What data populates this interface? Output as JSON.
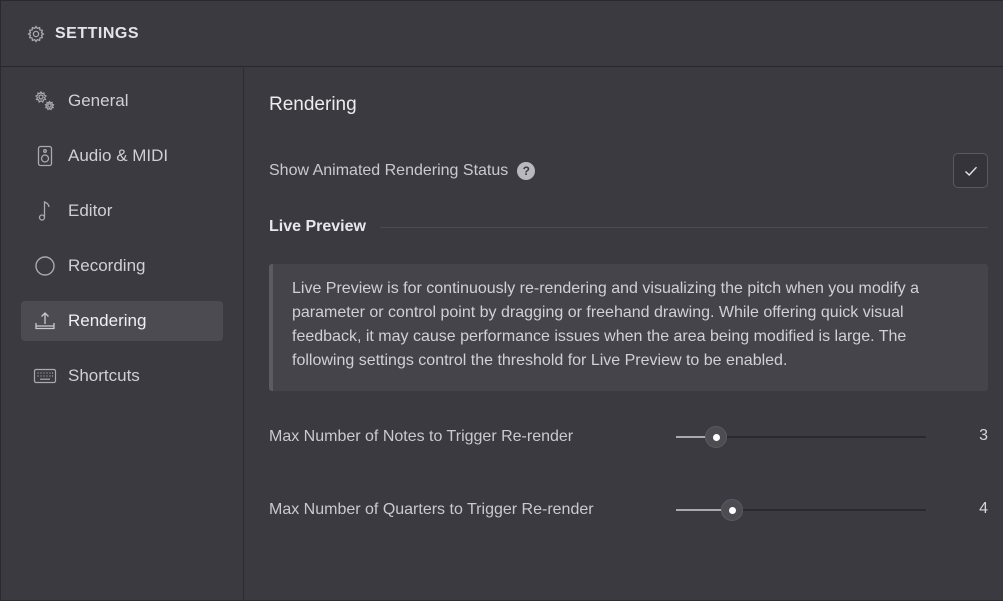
{
  "window": {
    "title": "SETTINGS",
    "icon": "gear-icon"
  },
  "sidebar": {
    "items": [
      {
        "label": "General",
        "icon": "gears-icon",
        "active": false
      },
      {
        "label": "Audio & MIDI",
        "icon": "speaker-icon",
        "active": false
      },
      {
        "label": "Editor",
        "icon": "music-note-icon",
        "active": false
      },
      {
        "label": "Recording",
        "icon": "record-circle-icon",
        "active": false
      },
      {
        "label": "Rendering",
        "icon": "upload-tray-icon",
        "active": true
      },
      {
        "label": "Shortcuts",
        "icon": "keyboard-icon",
        "active": false
      }
    ]
  },
  "main": {
    "title": "Rendering",
    "animated_status": {
      "label": "Show Animated Rendering Status",
      "help": "?",
      "checked": true
    },
    "live_preview": {
      "title": "Live Preview",
      "info": "Live Preview is for continuously re-rendering and visualizing the pitch when you modify a parameter or control point by dragging or freehand drawing. While offering quick visual feedback, it may cause performance issues when the area being modified is large. The following settings control the threshold for Live Preview to be enabled.",
      "sliders": [
        {
          "label": "Max Number of Notes to Trigger Re-render",
          "value": "3",
          "fraction": 0.16
        },
        {
          "label": "Max Number of Quarters to Trigger Re-render",
          "value": "4",
          "fraction": 0.225
        }
      ]
    }
  },
  "colors": {
    "window_bg": "#3b3a40",
    "active_item_bg": "#4c4b52",
    "info_bg": "#45444a"
  }
}
